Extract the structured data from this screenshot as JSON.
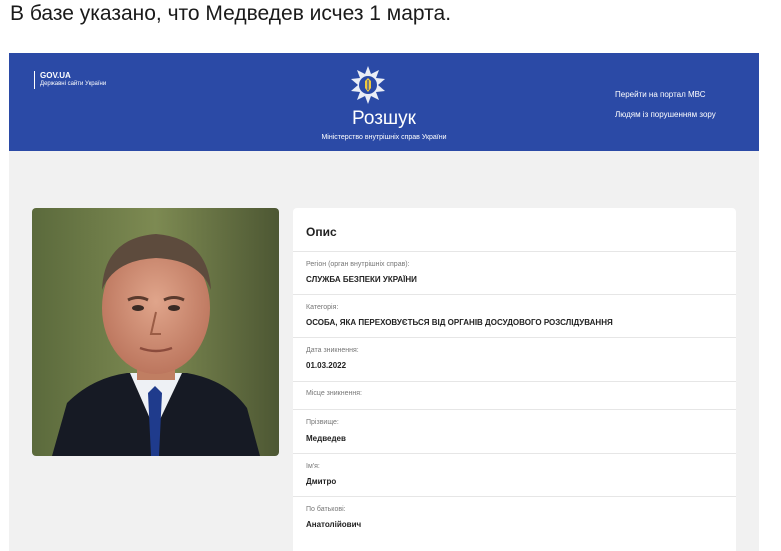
{
  "caption": "В базе указано, что Медведев исчез 1 марта.",
  "header": {
    "gov_title": "GOV.UA",
    "gov_subtitle": "Державні сайти України",
    "title": "Розшук",
    "subtitle": "Міністерство внутрішніх справ України",
    "link_portal": "Перейти на портал МВС",
    "link_accessibility": "Людям із порушенням зору",
    "bg_color": "#2b4aa6"
  },
  "card": {
    "title": "Опис",
    "fields": [
      {
        "label": "Регіон (орган внутрішніх справ):",
        "value": "СЛУЖБА БЕЗПЕКИ УКРАЇНИ"
      },
      {
        "label": "Категорія:",
        "value": "ОСОБА, ЯКА ПЕРЕХОВУЄТЬСЯ ВІД ОРГАНІВ ДОСУДОВОГО РОЗСЛІДУВАННЯ"
      },
      {
        "label": "Дата зникнення:",
        "value": "01.03.2022"
      },
      {
        "label": "Місце зникнення:",
        "value": ""
      },
      {
        "label": "Прізвище:",
        "value": "Медведев"
      },
      {
        "label": "Ім'я:",
        "value": "Дмитро"
      },
      {
        "label": "По батькові:",
        "value": "Анатолійович"
      }
    ]
  },
  "icons": {
    "emblem": "police-emblem-icon",
    "photo": "person-photo"
  }
}
